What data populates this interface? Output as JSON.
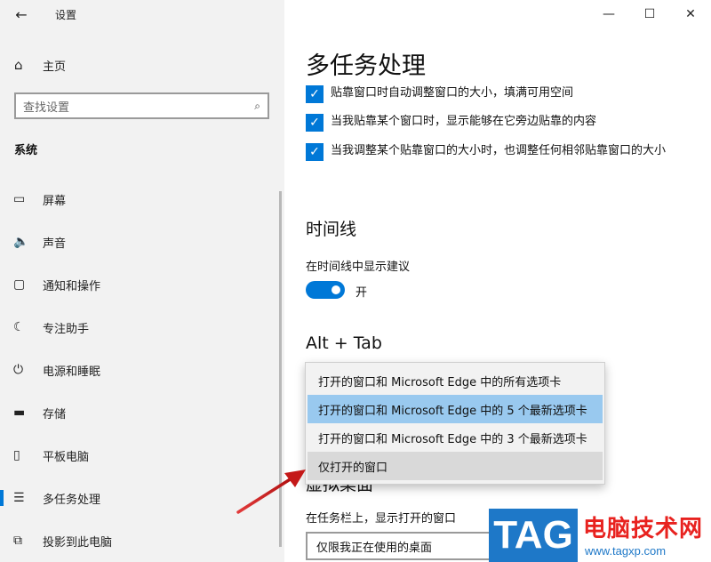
{
  "window": {
    "title": "设置",
    "back_icon": "arrow-left-icon",
    "minimize_glyph": "—",
    "maximize_glyph": "☐",
    "close_glyph": "✕"
  },
  "sidebar": {
    "home_label": "主页",
    "search_placeholder": "查找设置",
    "section_title": "系统",
    "items": [
      {
        "label": "屏幕",
        "icon": "monitor-icon",
        "glyph": "▭"
      },
      {
        "label": "声音",
        "icon": "speaker-icon",
        "glyph": "🔈"
      },
      {
        "label": "通知和操作",
        "icon": "notification-icon",
        "glyph": "▢"
      },
      {
        "label": "专注助手",
        "icon": "moon-icon",
        "glyph": "☾"
      },
      {
        "label": "电源和睡眠",
        "icon": "power-icon",
        "glyph": "⏻"
      },
      {
        "label": "存储",
        "icon": "storage-icon",
        "glyph": "▬"
      },
      {
        "label": "平板电脑",
        "icon": "tablet-icon",
        "glyph": "▯"
      },
      {
        "label": "多任务处理",
        "icon": "multitask-icon",
        "glyph": "☰",
        "active": true
      },
      {
        "label": "投影到此电脑",
        "icon": "project-icon",
        "glyph": "⧉"
      }
    ]
  },
  "main": {
    "page_title": "多任务处理",
    "snap_options": [
      {
        "label": "贴靠窗口时自动调整窗口的大小，填满可用空间",
        "checked": true
      },
      {
        "label": "当我贴靠某个窗口时，显示能够在它旁边贴靠的内容",
        "checked": true
      },
      {
        "label": "当我调整某个贴靠窗口的大小时，也调整任何相邻贴靠窗口的大小",
        "checked": true
      }
    ],
    "timeline_title": "时间线",
    "timeline_setting_label": "在时间线中显示建议",
    "timeline_toggle_state": "开",
    "timeline_toggle_on": true,
    "alttab_title": "Alt + Tab",
    "alttab_options": [
      "打开的窗口和 Microsoft Edge 中的所有选项卡",
      "打开的窗口和 Microsoft Edge 中的 5 个最新选项卡",
      "打开的窗口和 Microsoft Edge 中的 3 个最新选项卡",
      "仅打开的窗口"
    ],
    "alttab_selected_index": 1,
    "alttab_hover_index": 3,
    "desktops_title": "虚拟桌面",
    "taskbar_label": "在任务栏上，显示打开的窗口",
    "taskbar_value": "仅限我正在使用的桌面"
  },
  "watermark": {
    "tag_text": "TAG",
    "site_name": "电脑技术网",
    "url": "www.tagxp.com"
  },
  "colors": {
    "accent": "#0078d7",
    "sidebar_bg": "#f2f2f2",
    "selected_option": "#99c9ef",
    "arrow": "#d42020"
  }
}
